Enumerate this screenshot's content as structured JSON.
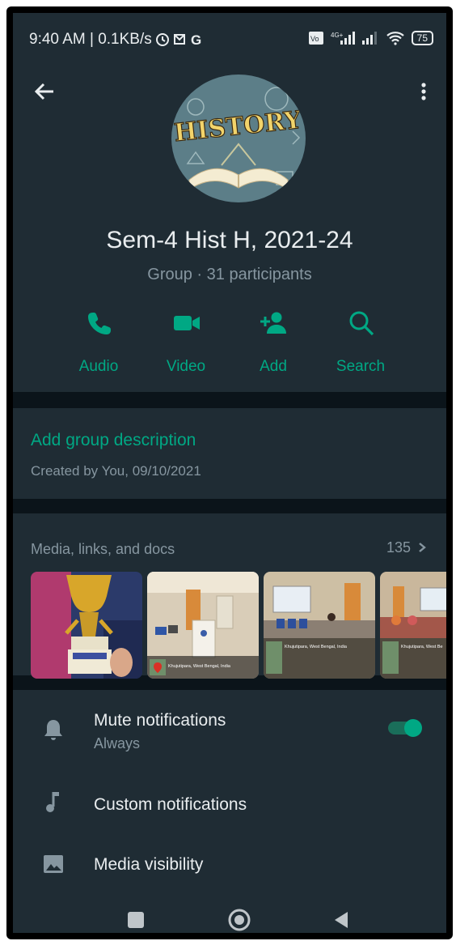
{
  "status_bar": {
    "time": "9:40 AM | 0.1KB/s",
    "battery": "75"
  },
  "header": {
    "avatar_text": "HISTORY",
    "title": "Sem-4 Hist H, 2021-24",
    "subtitle": "Group · 31 participants"
  },
  "actions": [
    {
      "label": "Audio",
      "icon": "phone-icon"
    },
    {
      "label": "Video",
      "icon": "video-camera-icon"
    },
    {
      "label": "Add",
      "icon": "add-person-icon"
    },
    {
      "label": "Search",
      "icon": "search-icon"
    }
  ],
  "description": {
    "link": "Add group description",
    "created": "Created by You, 09/10/2021"
  },
  "media": {
    "title": "Media, links, and docs",
    "count": "135",
    "thumbnails": [
      {
        "caption": ""
      },
      {
        "caption": "Khujutipara, West Bengal, India"
      },
      {
        "caption": "Khujutipara, West Bengal, India"
      },
      {
        "caption": "Khujutipara, West Be"
      }
    ]
  },
  "settings": {
    "mute": {
      "title": "Mute notifications",
      "subtitle": "Always",
      "enabled": true
    },
    "custom": {
      "title": "Custom notifications"
    },
    "media_visibility": {
      "title": "Media visibility"
    }
  },
  "colors": {
    "accent": "#00a884",
    "background": "#0b141a",
    "surface": "#1f2c34",
    "text": "#e9edef",
    "muted": "#8696a0"
  }
}
